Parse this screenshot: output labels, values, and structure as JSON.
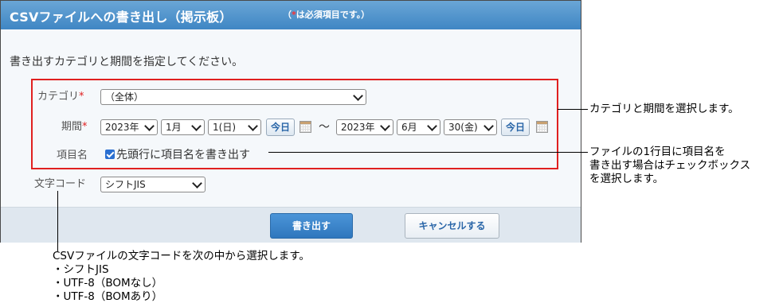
{
  "dialog": {
    "title": "CSVファイルへの書き出し（掲示板）",
    "note_prefix": "（",
    "note_required_mark": "*",
    "note_text": "は必須項目です。）",
    "instruction": "書き出すカテゴリと期間を指定してください。"
  },
  "form": {
    "category": {
      "label": "カテゴリ",
      "required_mark": "*",
      "value": "（全体）"
    },
    "period": {
      "label": "期間",
      "required_mark": "*",
      "start": {
        "year": "2023年",
        "month": "1月",
        "day": "1(日)"
      },
      "end": {
        "year": "2023年",
        "month": "6月",
        "day": "30(金)"
      },
      "today_label": "今日",
      "separator": "〜"
    },
    "item_name": {
      "label": "項目名",
      "checkbox_label": "先頭行に項目名を書き出す",
      "checked": true
    },
    "encoding": {
      "label": "文字コード",
      "value": "シフトJIS"
    }
  },
  "footer": {
    "export_label": "書き出す",
    "cancel_label": "キャンセルする"
  },
  "callouts": {
    "category_period": "カテゴリと期間を選択します。",
    "item_name_line1": "ファイルの1行目に項目名を",
    "item_name_line2": "書き出す場合はチェックボックス",
    "item_name_line3": "を選択します。",
    "encoding_line1": "CSVファイルの文字コードを次の中から選択します。",
    "encoding_line2": "・シフトJIS",
    "encoding_line3": "・UTF-8（BOMなし）",
    "encoding_line4": "・UTF-8（BOMあり）"
  },
  "colors": {
    "header": "#3f86c4",
    "highlight_border": "#e02020",
    "primary_button": "#2f77bd"
  }
}
